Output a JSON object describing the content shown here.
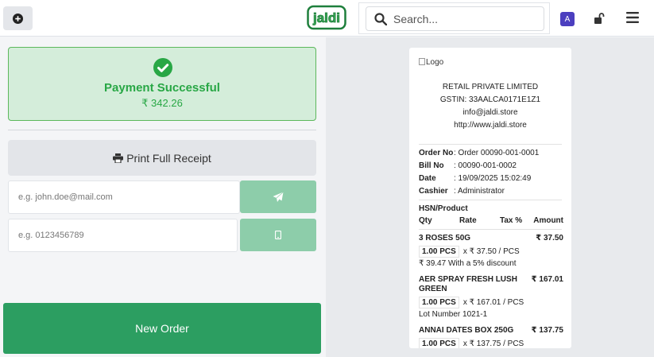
{
  "header": {
    "logo_text": "jaldi",
    "search_placeholder": "Search...",
    "avatar_letter": "A"
  },
  "payment": {
    "title": "Payment Successful",
    "amount": "₹ 342.26"
  },
  "actions": {
    "print_label": "Print Full Receipt",
    "email_placeholder": "e.g. john.doe@mail.com",
    "phone_placeholder": "e.g. 0123456789",
    "new_order_label": "New Order"
  },
  "receipt": {
    "logo_alt": "Logo",
    "company": "RETAIL PRIVATE LIMITED",
    "gstin": "GSTIN: 33AALCA0171E1Z1",
    "email": "info@jaldi.store",
    "website": "http://www.jaldi.store",
    "meta": [
      {
        "key": "Order No",
        "value": ": Order 00090-001-0001"
      },
      {
        "key": "Bill No",
        "value": ": 00090-001-0002"
      },
      {
        "key": "Date",
        "value": ": 19/09/2025 15:02:49"
      },
      {
        "key": "Cashier",
        "value": ": Administrator"
      }
    ],
    "section_title": "HSN/Product",
    "columns": [
      "Qty",
      "Rate",
      "Tax %",
      "Amount"
    ],
    "items": [
      {
        "name": "3 ROSES 50G",
        "amount": "₹ 37.50",
        "qty": "1.00 PCS",
        "rate": "x ₹ 37.50 / PCS",
        "note": "₹ 39.47 With a 5% discount"
      },
      {
        "name": "AER SPRAY FRESH LUSH GREEN",
        "amount": "₹ 167.01",
        "qty": "1.00 PCS",
        "rate": "x ₹ 167.01 / PCS",
        "note": "Lot Number 1021-1"
      },
      {
        "name": "ANNAI DATES BOX 250G",
        "amount": "₹ 137.75",
        "qty": "1.00 PCS",
        "rate": "x ₹ 137.75 / PCS",
        "note": ""
      }
    ]
  },
  "colors": {
    "accent_green": "#2c9e61",
    "success_bg": "#d4edda",
    "light_green_button": "#8dcdaa",
    "avatar_purple": "#4c3fbf"
  }
}
